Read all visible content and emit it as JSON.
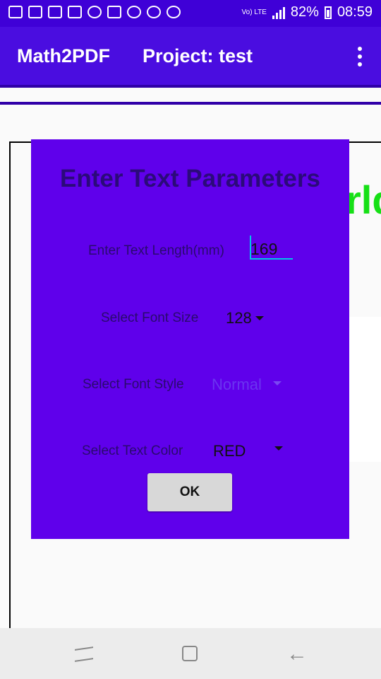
{
  "status_bar": {
    "battery": "82%",
    "time": "08:59",
    "network": "Vo) LTE"
  },
  "app_bar": {
    "title": "Math2PDF",
    "project": "Project: test"
  },
  "background": {
    "partial_text": "rld",
    "text_color": "#16e016"
  },
  "dialog": {
    "title": "Enter Text Parameters",
    "length_label": "Enter Text Length(mm)",
    "length_value": "169",
    "font_size_label": "Select Font Size",
    "font_size_value": "128",
    "font_style_label": "Select Font Style",
    "font_style_value": "Normal",
    "text_color_label": "Select Text Color",
    "text_color_value": "RED",
    "ok_label": "OK",
    "background_color": "#5f00eb"
  }
}
